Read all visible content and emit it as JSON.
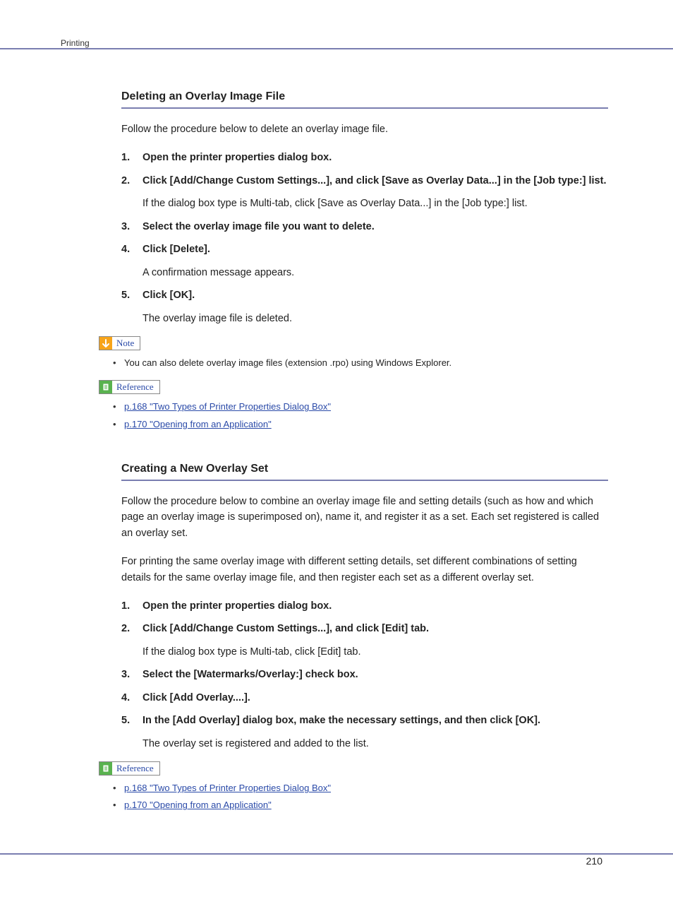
{
  "header": {
    "section_label": "Printing"
  },
  "page_number": "210",
  "sections": [
    {
      "heading": "Deleting an Overlay Image File",
      "intro": "Follow the procedure below to delete an overlay image file.",
      "steps": [
        {
          "num": "1.",
          "title": "Open the printer properties dialog box.",
          "body": ""
        },
        {
          "num": "2.",
          "title": "Click [Add/Change Custom Settings...], and click [Save as Overlay Data...] in the [Job type:] list.",
          "body": "If the dialog box type is Multi-tab, click [Save as Overlay Data...] in the [Job type:] list."
        },
        {
          "num": "3.",
          "title": "Select the overlay image file you want to delete.",
          "body": ""
        },
        {
          "num": "4.",
          "title": "Click [Delete].",
          "body": "A confirmation message appears."
        },
        {
          "num": "5.",
          "title": "Click [OK].",
          "body": "The overlay image file is deleted."
        }
      ],
      "note_label": "Note",
      "note_bullets": [
        "You can also delete overlay image files (extension .rpo) using Windows Explorer."
      ],
      "reference_label": "Reference",
      "reference_links": [
        "p.168 \"Two Types of Printer Properties Dialog Box\"",
        "p.170 \"Opening from an Application\""
      ]
    },
    {
      "heading": "Creating a New Overlay Set",
      "intro": "Follow the procedure below to combine an overlay image file and setting details (such as how and which page an overlay image is superimposed on), name it, and register it as a set. Each set registered is called an overlay set.",
      "intro2": "For printing the same overlay image with different setting details, set different combinations of setting details for the same overlay image file, and then register each set as a different overlay set.",
      "steps": [
        {
          "num": "1.",
          "title": "Open the printer properties dialog box.",
          "body": ""
        },
        {
          "num": "2.",
          "title": "Click [Add/Change Custom Settings...], and click [Edit] tab.",
          "body": "If the dialog box type is Multi-tab, click [Edit] tab."
        },
        {
          "num": "3.",
          "title": "Select the [Watermarks/Overlay:] check box.",
          "body": ""
        },
        {
          "num": "4.",
          "title": "Click [Add Overlay....].",
          "body": ""
        },
        {
          "num": "5.",
          "title": "In the [Add Overlay] dialog box, make the necessary settings, and then click [OK].",
          "body": "The overlay set is registered and added to the list."
        }
      ],
      "reference_label": "Reference",
      "reference_links": [
        "p.168 \"Two Types of Printer Properties Dialog Box\"",
        "p.170 \"Opening from an Application\""
      ]
    }
  ]
}
